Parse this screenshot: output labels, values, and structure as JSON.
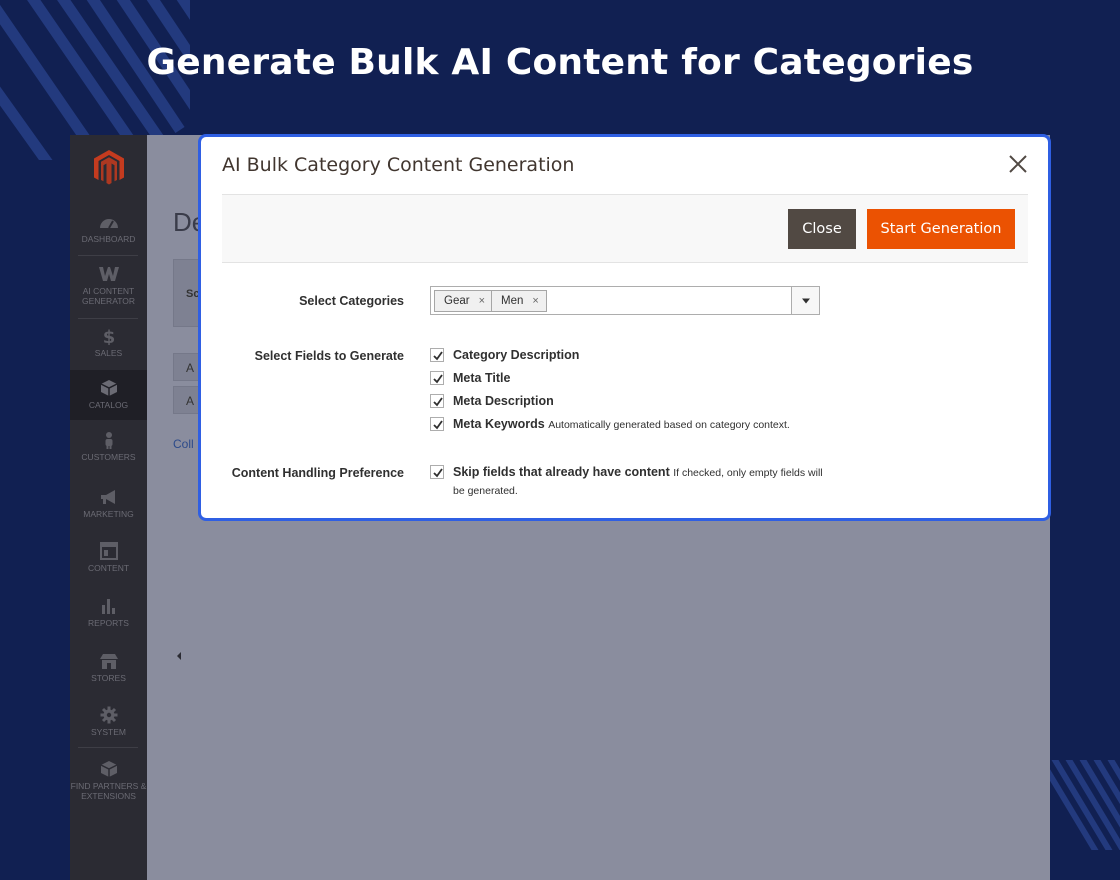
{
  "headline": "Generate Bulk AI Content for Categories",
  "colors": {
    "background": "#112052",
    "modal_border": "#2f5fe3",
    "primary_button": "#eb5202",
    "secondary_button": "#514943",
    "sidebar": "#2b2b33"
  },
  "sidebar": {
    "logo": "magento-logo-icon",
    "items": [
      {
        "label": "DASHBOARD",
        "icon": "dashboard-icon"
      },
      {
        "label": "AI CONTENT GENERATOR",
        "icon": "w-logo-icon"
      },
      {
        "label": "SALES",
        "icon": "dollar-icon"
      },
      {
        "label": "CATALOG",
        "icon": "box-icon"
      },
      {
        "label": "CUSTOMERS",
        "icon": "person-icon"
      },
      {
        "label": "MARKETING",
        "icon": "megaphone-icon"
      },
      {
        "label": "CONTENT",
        "icon": "layout-icon"
      },
      {
        "label": "REPORTS",
        "icon": "bar-chart-icon"
      },
      {
        "label": "STORES",
        "icon": "storefront-icon"
      },
      {
        "label": "SYSTEM",
        "icon": "gear-icon"
      },
      {
        "label": "FIND PARTNERS & EXTENSIONS",
        "icon": "cube-icon"
      }
    ]
  },
  "background_page": {
    "title_fragment": "De",
    "box1": "Sc",
    "box2": "A",
    "box3": "A",
    "link_fragment": "Coll"
  },
  "modal": {
    "title": "AI Bulk Category Content Generation",
    "close_icon": "close-icon",
    "buttons": {
      "close": "Close",
      "start": "Start Generation"
    },
    "select_categories": {
      "label": "Select Categories",
      "selected": [
        "Gear",
        "Men"
      ],
      "remove_symbol": "×"
    },
    "fields": {
      "label": "Select Fields to Generate",
      "options": [
        {
          "label": "Category Description",
          "checked": true,
          "note": ""
        },
        {
          "label": "Meta Title",
          "checked": true,
          "note": ""
        },
        {
          "label": "Meta Description",
          "checked": true,
          "note": ""
        },
        {
          "label": "Meta Keywords",
          "checked": true,
          "note": "Automatically generated based on category context."
        }
      ]
    },
    "content_handling": {
      "label": "Content Handling Preference",
      "option_label": "Skip fields that already have content",
      "checked": true,
      "note": "If checked, only empty fields will be generated."
    }
  }
}
